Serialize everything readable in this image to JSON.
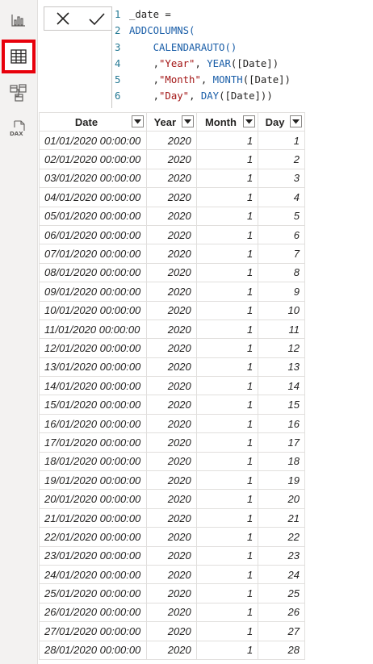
{
  "rail": {
    "items": [
      {
        "name": "report-view-icon",
        "active": false
      },
      {
        "name": "data-view-icon",
        "active": true
      },
      {
        "name": "model-view-icon",
        "active": false
      },
      {
        "name": "dax-query-view-icon",
        "active": false,
        "label": "DAX"
      }
    ],
    "active_outline_color": "#e8000b"
  },
  "formula": {
    "cancel_icon": "close-icon",
    "commit_icon": "check-icon",
    "lines": [
      {
        "num": "1",
        "segments": [
          {
            "t": "_date =",
            "k": "plain"
          }
        ]
      },
      {
        "num": "2",
        "segments": [
          {
            "t": "ADDCOLUMNS(",
            "k": "kw"
          }
        ]
      },
      {
        "num": "3",
        "segments": [
          {
            "t": "    CALENDARAUTO()",
            "k": "kw"
          }
        ]
      },
      {
        "num": "4",
        "segments": [
          {
            "t": "    ,",
            "k": "plain"
          },
          {
            "t": "\"Year\"",
            "k": "str"
          },
          {
            "t": ", ",
            "k": "plain"
          },
          {
            "t": "YEAR",
            "k": "kw"
          },
          {
            "t": "([Date])",
            "k": "plain"
          }
        ]
      },
      {
        "num": "5",
        "segments": [
          {
            "t": "    ,",
            "k": "plain"
          },
          {
            "t": "\"Month\"",
            "k": "str"
          },
          {
            "t": ", ",
            "k": "plain"
          },
          {
            "t": "MONTH",
            "k": "kw"
          },
          {
            "t": "([Date])",
            "k": "plain"
          }
        ]
      },
      {
        "num": "6",
        "segments": [
          {
            "t": "    ,",
            "k": "plain"
          },
          {
            "t": "\"Day\"",
            "k": "str"
          },
          {
            "t": ", ",
            "k": "plain"
          },
          {
            "t": "DAY",
            "k": "kw"
          },
          {
            "t": "([Date]))",
            "k": "plain"
          }
        ]
      }
    ]
  },
  "table": {
    "columns": [
      "Date",
      "Year",
      "Month",
      "Day"
    ],
    "rows": [
      [
        "01/01/2020 00:00:00",
        "2020",
        "1",
        "1"
      ],
      [
        "02/01/2020 00:00:00",
        "2020",
        "1",
        "2"
      ],
      [
        "03/01/2020 00:00:00",
        "2020",
        "1",
        "3"
      ],
      [
        "04/01/2020 00:00:00",
        "2020",
        "1",
        "4"
      ],
      [
        "05/01/2020 00:00:00",
        "2020",
        "1",
        "5"
      ],
      [
        "06/01/2020 00:00:00",
        "2020",
        "1",
        "6"
      ],
      [
        "07/01/2020 00:00:00",
        "2020",
        "1",
        "7"
      ],
      [
        "08/01/2020 00:00:00",
        "2020",
        "1",
        "8"
      ],
      [
        "09/01/2020 00:00:00",
        "2020",
        "1",
        "9"
      ],
      [
        "10/01/2020 00:00:00",
        "2020",
        "1",
        "10"
      ],
      [
        "11/01/2020 00:00:00",
        "2020",
        "1",
        "11"
      ],
      [
        "12/01/2020 00:00:00",
        "2020",
        "1",
        "12"
      ],
      [
        "13/01/2020 00:00:00",
        "2020",
        "1",
        "13"
      ],
      [
        "14/01/2020 00:00:00",
        "2020",
        "1",
        "14"
      ],
      [
        "15/01/2020 00:00:00",
        "2020",
        "1",
        "15"
      ],
      [
        "16/01/2020 00:00:00",
        "2020",
        "1",
        "16"
      ],
      [
        "17/01/2020 00:00:00",
        "2020",
        "1",
        "17"
      ],
      [
        "18/01/2020 00:00:00",
        "2020",
        "1",
        "18"
      ],
      [
        "19/01/2020 00:00:00",
        "2020",
        "1",
        "19"
      ],
      [
        "20/01/2020 00:00:00",
        "2020",
        "1",
        "20"
      ],
      [
        "21/01/2020 00:00:00",
        "2020",
        "1",
        "21"
      ],
      [
        "22/01/2020 00:00:00",
        "2020",
        "1",
        "22"
      ],
      [
        "23/01/2020 00:00:00",
        "2020",
        "1",
        "23"
      ],
      [
        "24/01/2020 00:00:00",
        "2020",
        "1",
        "24"
      ],
      [
        "25/01/2020 00:00:00",
        "2020",
        "1",
        "25"
      ],
      [
        "26/01/2020 00:00:00",
        "2020",
        "1",
        "26"
      ],
      [
        "27/01/2020 00:00:00",
        "2020",
        "1",
        "27"
      ],
      [
        "28/01/2020 00:00:00",
        "2020",
        "1",
        "28"
      ]
    ]
  }
}
